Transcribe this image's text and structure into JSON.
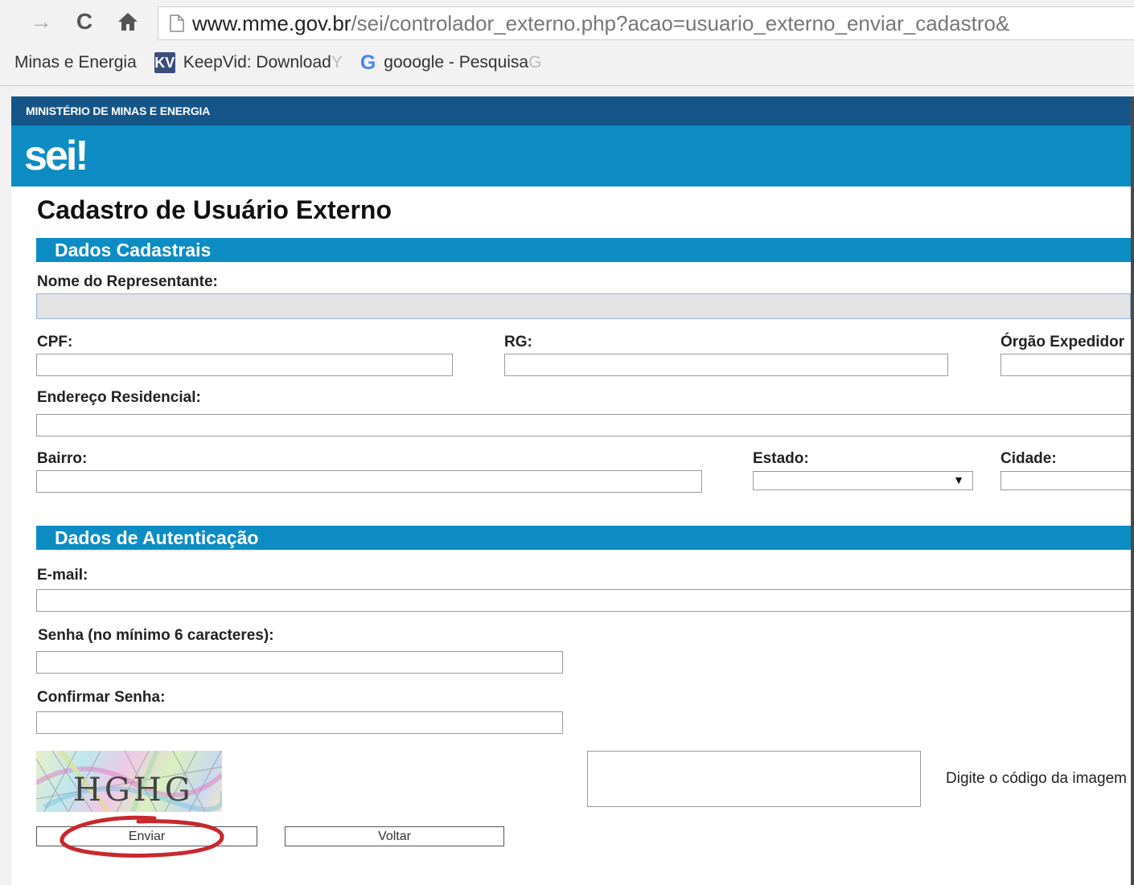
{
  "browser": {
    "url_host": "www.mme.gov.br",
    "url_path": "/sei/controlador_externo.php?acao=usuario_externo_enviar_cadastro&",
    "bookmarks": [
      {
        "label": "Minas e Energia",
        "icon": "none"
      },
      {
        "label": "KeepVid: Download ",
        "fade": "Y",
        "icon": "kv-icon"
      },
      {
        "label": "gooogle - Pesquisa ",
        "fade": "G",
        "icon": "google-icon"
      }
    ],
    "kv_icon_text": "KV",
    "google_icon_text": "G"
  },
  "header": {
    "ministry": "MINISTÉRIO DE MINAS E ENERGIA",
    "logo": "sei",
    "logo_mark": "!"
  },
  "page_title": "Cadastro de Usuário Externo",
  "section_cadastrais": {
    "title": "Dados Cadastrais",
    "nome_label": "Nome do Representante:",
    "cpf_label": "CPF:",
    "rg_label": "RG:",
    "orgao_label": "Órgão Expedidor",
    "endereco_label": "Endereço Residencial:",
    "bairro_label": "Bairro:",
    "estado_label": "Estado:",
    "estado_value": "",
    "cidade_label": "Cidade:"
  },
  "section_autenticacao": {
    "title": "Dados de Autenticação",
    "email_label": "E-mail:",
    "senha_label": "Senha (no mínimo 6 caracteres):",
    "confirmar_label": "Confirmar Senha:",
    "captcha_code": "HGHG",
    "captcha_hint": "Digite o código da imagem"
  },
  "buttons": {
    "enviar": "Enviar",
    "voltar": "Voltar"
  },
  "colors": {
    "ministry_bar": "#155588",
    "brand_blue": "#0d8cc4",
    "highlight_circle": "#c8282d"
  }
}
